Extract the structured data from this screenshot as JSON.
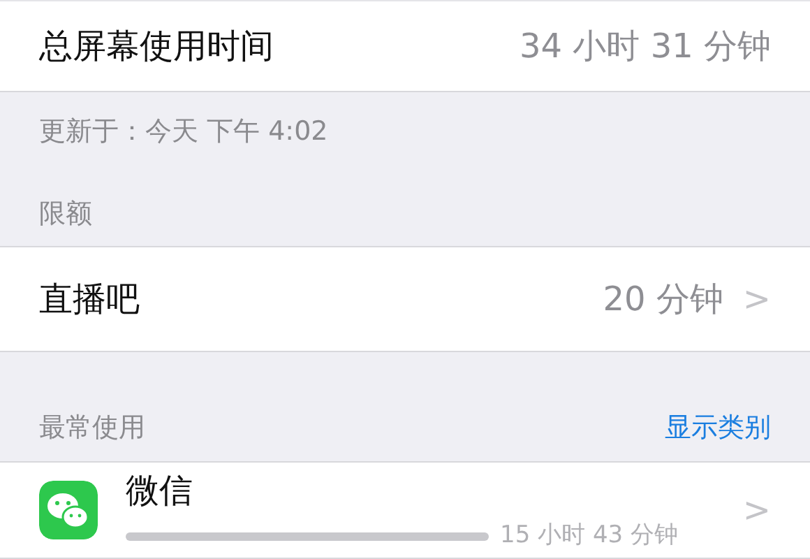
{
  "total": {
    "label": "总屏幕使用时间",
    "value": "34 小时 31 分钟"
  },
  "updated": "更新于：今天 下午 4:02",
  "limits": {
    "header": "限额",
    "items": [
      {
        "label": "直播吧",
        "value": "20 分钟",
        "chevron": ">"
      }
    ]
  },
  "most_used": {
    "header": "最常使用",
    "action": "显示类别",
    "apps": [
      {
        "name": "微信",
        "time": "15 小时 43 分钟",
        "chevron": ">",
        "color": "#2dc84d"
      }
    ]
  }
}
